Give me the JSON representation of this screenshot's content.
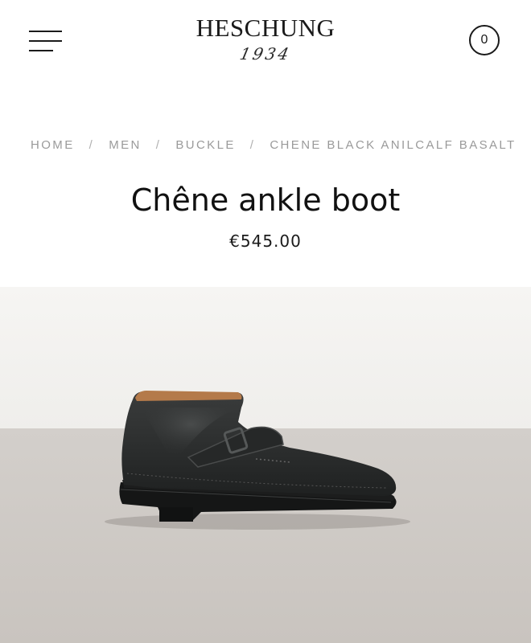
{
  "header": {
    "menu_icon": "hamburger-menu-icon",
    "logo": {
      "wordmark": "HESCHUNG",
      "year": "1934"
    },
    "cart_count": "0"
  },
  "breadcrumb": {
    "items": [
      "HOME",
      "MEN",
      "BUCKLE",
      "CHENE BLACK ANILCALF BASALT"
    ],
    "separator": "/"
  },
  "product": {
    "title": "Chêne ankle boot",
    "price": "€545.00",
    "image": "black-leather-buckle-ankle-boot"
  },
  "colors": {
    "text": "#111111",
    "breadcrumb": "#9a9a9a",
    "wall": "#f4f3f1",
    "floor": "#cfcac6",
    "leather": "#2e3030"
  }
}
